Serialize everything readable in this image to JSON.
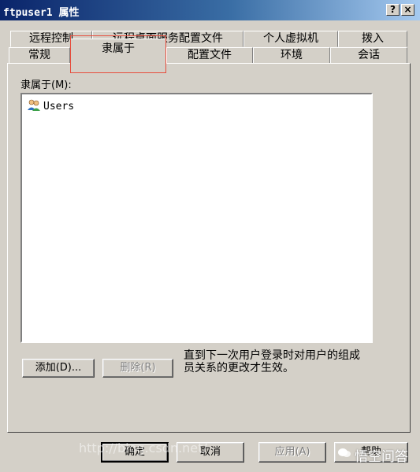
{
  "window": {
    "title": "ftpuser1 属性",
    "help_button": "?",
    "close_button": "×"
  },
  "tabs_row1": [
    "远程控制",
    "远程桌面服务配置文件",
    "个人虚拟机",
    "拨入"
  ],
  "tabs_row2": [
    "常规",
    "隶属于",
    "配置文件",
    "环境",
    "会话"
  ],
  "active_tab": "隶属于",
  "member_of": {
    "label": "隶属于(M):",
    "items": [
      "Users"
    ]
  },
  "buttons": {
    "add": "添加(D)...",
    "remove": "删除(R)",
    "ok": "确定",
    "cancel": "取消",
    "apply": "应用(A)",
    "help": "帮助"
  },
  "note": "直到下一次用户登录时对用户的组成员关系的更改才生效。",
  "watermark": "http://blog.csdn.net/",
  "brand": "悟空问答",
  "colors": {
    "title_start": "#0a246a",
    "title_end": "#a6caf0",
    "face": "#d4d0c8",
    "highlight": "#e74c3c"
  }
}
